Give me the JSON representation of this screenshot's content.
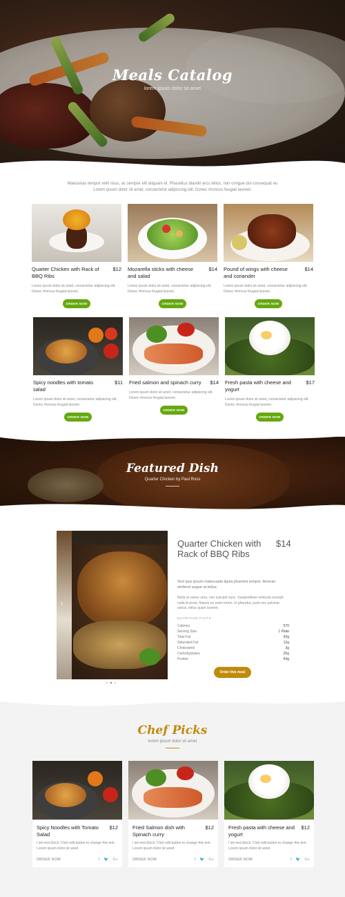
{
  "hero": {
    "title": "Meals Catalog",
    "subtitle": "lorem ipsum dolor sit amet"
  },
  "intro": "Maecenas tempor velit risus, ac semper elit aliquam et. Phasellus blandit arcu tellus, non congue dui consequat eu Lorem ipsum dolor sit amet, consectetur adipiscing elit. Donec rhoncus feugiat laoreet.",
  "menu": [
    {
      "name": "Quarter Chicken with Rack of BBQ Ribs",
      "price": "$12",
      "desc": "Lorem ipsum dolor sit amet, consectetur adipiscing elit. Donec rhoncus feugiat laoreet.",
      "button": "ORDER NOW"
    },
    {
      "name": "Mozarella sticks with cheese and salad",
      "price": "$14",
      "desc": "Lorem ipsum dolor sit amet, consectetur adipiscing elit. Donec rhoncus feugiat laoreet.",
      "button": "ORDER NOW"
    },
    {
      "name": "Pound of wings with cheese and coriander",
      "price": "$14",
      "desc": "Lorem ipsum dolor sit amet, consectetur adipiscing elit. Donec rhoncus feugiat laoreet.",
      "button": "ORDER NOW"
    },
    {
      "name": "Spicy noodles with tomato salad",
      "price": "$11",
      "desc": "Lorem ipsum dolor sit amet, consectetur adipiscing elit. Donec rhoncus feugiat laoreet.",
      "button": "ORDER NOW"
    },
    {
      "name": "Fried salmon and spinach curry",
      "price": "$14",
      "desc": "Lorem ipsum dolor sit amet, consectetur adipiscing elit. Donec rhoncus feugiat laoreet.",
      "button": "ORDER NOW"
    },
    {
      "name": "Fresh pasta with cheese and yogurt",
      "price": "$17",
      "desc": "Lorem ipsum dolor sit amet, consectetur adipiscing elit. Donec rhoncus feugiat laoreet.",
      "button": "ORDER NOW"
    }
  ],
  "featured_banner": {
    "title": "Featured Dish",
    "subtitle": "Quarter Chicken by Paul Ross"
  },
  "featured": {
    "title": "Quarter Chicken with Rack of BBQ Ribs",
    "price": "$14",
    "p1": "Sed quis ipsum malesuada ligula pharetra tempor. Aenean eleifend augue at tellus.",
    "p2": "Nulla at varius urna, non suscipit nunc. Suspendisse vehicula suscipit nulla id porta. Mauris eu enim lorem. In pharetra, justo nec pulvinar varius, tellus quam laoreet.",
    "nutrition_label": "NUTRITION FACTS",
    "nutrition": [
      {
        "label": "Calories",
        "value": "570"
      },
      {
        "label": "Serving Size",
        "value": "1 Plate"
      },
      {
        "label": "Total Fat",
        "value": "42g"
      },
      {
        "label": "Saturated Fat",
        "value": "12g"
      },
      {
        "label": "Cholesterol",
        "value": "3g"
      },
      {
        "label": "Carbohydrates",
        "value": "20g"
      },
      {
        "label": "Protein",
        "value": "64g"
      }
    ],
    "button": "Order this meal",
    "slider_prev": "‹"
  },
  "chef": {
    "title": "Chef Picks",
    "subtitle": "lorem ipsum dolor sit amet",
    "picks": [
      {
        "name": "Spicy Noodles with Tomato Salad",
        "price": "$12",
        "desc": "I am text block. Click edit button to change this text. Lorem ipsum dolor sit amet.",
        "order": "ORDER NOW"
      },
      {
        "name": "Fried Salmon dish with Spinach curry",
        "price": "$12",
        "desc": "I am text block. Click edit button to change this text. Lorem ipsum dolor sit amet.",
        "order": "ORDER NOW"
      },
      {
        "name": "Fresh pasta with cheese and yogurt",
        "price": "$12",
        "desc": "I am text block. Click edit button to change this text. Lorem ipsum dolor sit amet.",
        "order": "ORDER NOW"
      }
    ],
    "social": {
      "facebook": "f",
      "twitter": "🐦",
      "google": "G+"
    }
  },
  "colors": {
    "green": "#66a80f",
    "gold": "#c08a0c"
  }
}
